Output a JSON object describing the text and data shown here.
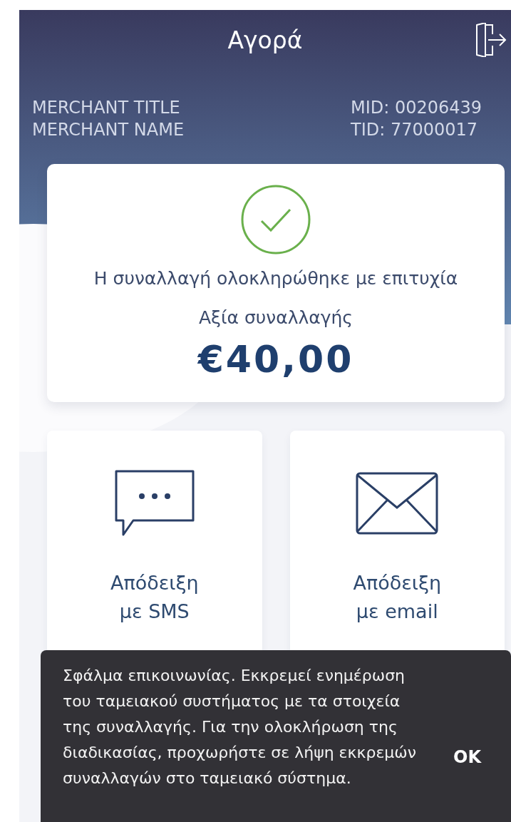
{
  "header": {
    "title": "Αγορά"
  },
  "merchant": {
    "lines": [
      "MERCHANT TITLE",
      "MERCHANT NAME"
    ],
    "ids": [
      "MID: 00206439",
      "TID: 77000017"
    ]
  },
  "result": {
    "success": true,
    "message": "Η συναλλαγή ολοκληρώθηκε με επιτυχία",
    "amount_label": "Αξία συναλλαγής",
    "amount": "€40,00"
  },
  "receipt_options": [
    {
      "kind": "sms",
      "label": "Απόδειξη με SMS"
    },
    {
      "kind": "email",
      "label": "Απόδειξη με email"
    }
  ],
  "snackbar": {
    "message": "Σφάλμα επικοινωνίας. Εκκρεμεί ενημέρωση του ταμειακού συστήματος με τα στοιχεία της συναλλαγής. Για την ολοκλήρωση της διαδικασίας, προχωρήστε σε λήψη εκκρεμών συναλλαγών στο ταμειακό σύστημα.",
    "action": "OK"
  }
}
